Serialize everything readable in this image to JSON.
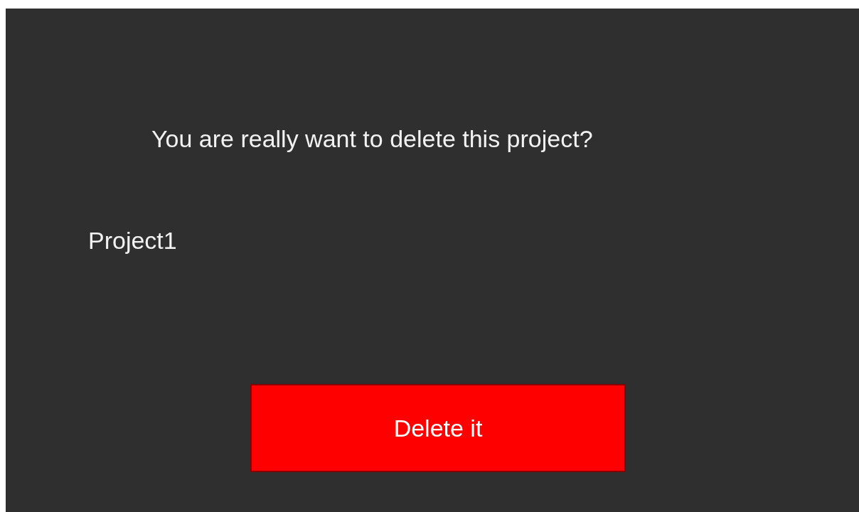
{
  "dialog": {
    "question": "You are really want to delete this project?",
    "project_name": "Project1",
    "button": "Delete it"
  }
}
